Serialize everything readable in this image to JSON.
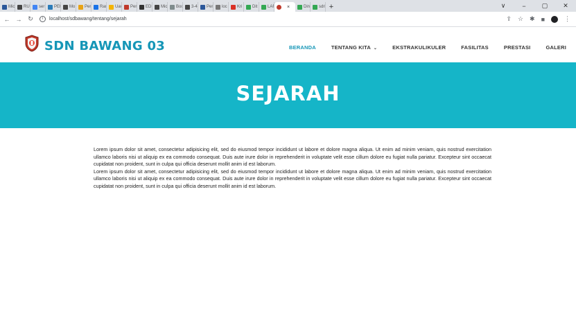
{
  "browser": {
    "tabs": [
      {
        "label": "Mic",
        "color": "#2b579a"
      },
      {
        "label": "RU",
        "color": "#444444"
      },
      {
        "label": "ser",
        "color": "#4285f4"
      },
      {
        "label": "PEt",
        "color": "#2b7bb9"
      },
      {
        "label": "Mo",
        "color": "#444444"
      },
      {
        "label": "Per",
        "color": "#e8a317"
      },
      {
        "label": "Ran",
        "color": "#1a73e8"
      },
      {
        "label": "Uav",
        "color": "#f4b400"
      },
      {
        "label": "Per",
        "color": "#c0392b"
      },
      {
        "label": "EDI",
        "color": "#333333"
      },
      {
        "label": "Mic",
        "color": "#444444"
      },
      {
        "label": "Boc",
        "color": "#7f8c8d"
      },
      {
        "label": "3-4",
        "color": "#444444"
      },
      {
        "label": "Pen",
        "color": "#2b579a"
      },
      {
        "label": "loc",
        "color": "#777777"
      },
      {
        "label": "Kri",
        "color": "#d93025"
      },
      {
        "label": "Dit",
        "color": "#34a853"
      },
      {
        "label": "LAF",
        "color": "#34a853"
      }
    ],
    "active_tab": {
      "close": "×",
      "color": "#c0392b"
    },
    "tabs_after": [
      {
        "label": "Din",
        "color": "#34a853"
      },
      {
        "label": "sdri",
        "color": "#34a853"
      }
    ],
    "new_tab": "+",
    "window_controls": {
      "dropdown": "∨",
      "minimize": "−",
      "maximize": "▢",
      "close": "✕"
    },
    "url": "localhost/sdbawang/tentang/sejarah"
  },
  "site": {
    "brand": "SDN BAWANG 03",
    "menu": {
      "beranda": "BERANDA",
      "tentang": "TENTANG KITA",
      "ekstra": "EKSTRAKULIKULER",
      "fasilitas": "FASILITAS",
      "prestasi": "PRESTASI",
      "galeri": "GALERI"
    },
    "accent": "#1596b7",
    "hero_color": "#15b5c8"
  },
  "page": {
    "title": "SEJARAH",
    "paragraphs": [
      "Lorem ipsum dolor sit amet, consectetur adipisicing elit, sed do eiusmod tempor incididunt ut labore et dolore magna aliqua. Ut enim ad minim veniam, quis nostrud exercitation ullamco laboris nisi ut aliquip ex ea commodo consequat. Duis aute irure dolor in reprehenderit in voluptate velit esse cillum dolore eu fugiat nulla pariatur. Excepteur sint occaecat cupidatat non proident, sunt in culpa qui officia deserunt mollit anim id est laborum.",
      "Lorem ipsum dolor sit amet, consectetur adipisicing elit, sed do eiusmod tempor incididunt ut labore et dolore magna aliqua. Ut enim ad minim veniam, quis nostrud exercitation ullamco laboris nisi ut aliquip ex ea commodo consequat. Duis aute irure dolor in reprehenderit in voluptate velit esse cillum dolore eu fugiat nulla pariatur. Excepteur sint occaecat cupidatat non proident, sunt in culpa qui officia deserunt mollit anim id est laborum."
    ]
  }
}
